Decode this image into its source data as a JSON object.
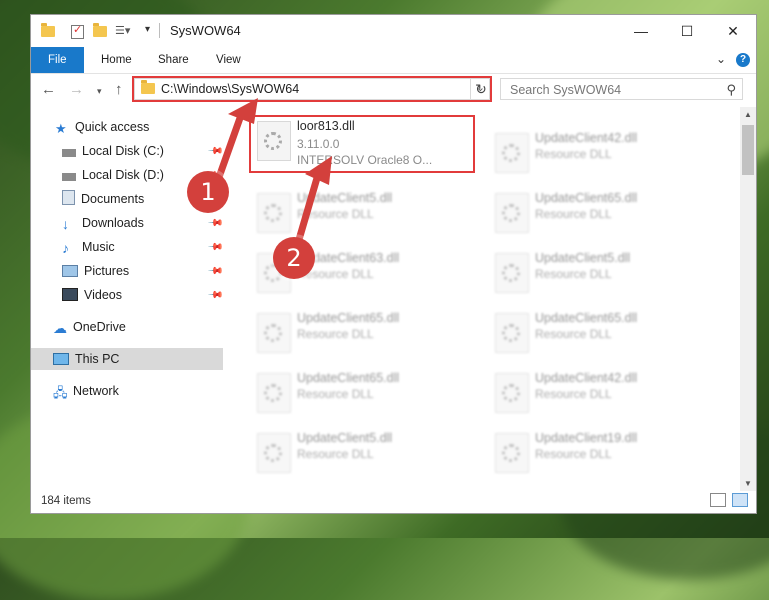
{
  "window": {
    "title": "SysWOW64",
    "accent": "#1979ca"
  },
  "ribbon": {
    "tabs": [
      {
        "label": "File"
      },
      {
        "label": "Home"
      },
      {
        "label": "Share"
      },
      {
        "label": "View"
      }
    ]
  },
  "winbtns": {
    "minimize": "—",
    "maximize": "☐",
    "close": "✕"
  },
  "address": {
    "path": "C:\\Windows\\SysWOW64"
  },
  "search": {
    "placeholder": "Search SysWOW64"
  },
  "sidebar": {
    "items": [
      {
        "label": "Quick access",
        "icon": "star-icon",
        "pinned": false
      },
      {
        "label": "Local Disk (C:)",
        "icon": "drive-icon",
        "pinned": true
      },
      {
        "label": "Local Disk (D:)",
        "icon": "drive-icon",
        "pinned": true
      },
      {
        "label": "Documents",
        "icon": "documents-icon",
        "pinned": true
      },
      {
        "label": "Downloads",
        "icon": "download-icon",
        "pinned": true
      },
      {
        "label": "Music",
        "icon": "music-icon",
        "pinned": true
      },
      {
        "label": "Pictures",
        "icon": "pictures-icon",
        "pinned": true
      },
      {
        "label": "Videos",
        "icon": "videos-icon",
        "pinned": true
      },
      {
        "label": "OneDrive",
        "icon": "cloud-icon",
        "pinned": false
      },
      {
        "label": "This PC",
        "icon": "pc-icon",
        "pinned": false,
        "selected": true
      },
      {
        "label": "Network",
        "icon": "network-icon",
        "pinned": false
      }
    ]
  },
  "files": {
    "focused": {
      "name": "loor813.dll",
      "version": "3.11.0.0",
      "description": "INTERSOLV Oracle8 O..."
    },
    "left_col": [
      {
        "name": "UpdateClient5.dll",
        "type": "Resource DLL"
      },
      {
        "name": "UpdateClient63.dll",
        "type": "Resource DLL"
      },
      {
        "name": "UpdateClient65.dll",
        "type": "Resource DLL"
      },
      {
        "name": "UpdateClient65.dll",
        "type": "Resource DLL"
      },
      {
        "name": "UpdateClient5.dll",
        "type": "Resource DLL"
      }
    ],
    "right_col": [
      {
        "name": "UpdateClient42.dll",
        "type": "Resource DLL"
      },
      {
        "name": "UpdateClient65.dll",
        "type": "Resource DLL"
      },
      {
        "name": "UpdateClient5.dll",
        "type": "Resource DLL"
      },
      {
        "name": "UpdateClient65.dll",
        "type": "Resource DLL"
      },
      {
        "name": "UpdateClient42.dll",
        "type": "Resource DLL"
      },
      {
        "name": "UpdateClient19.dll",
        "type": "Resource DLL"
      }
    ]
  },
  "status": {
    "count": "184 items"
  },
  "callouts": {
    "one": "1",
    "two": "2",
    "color": "#d3403c"
  }
}
